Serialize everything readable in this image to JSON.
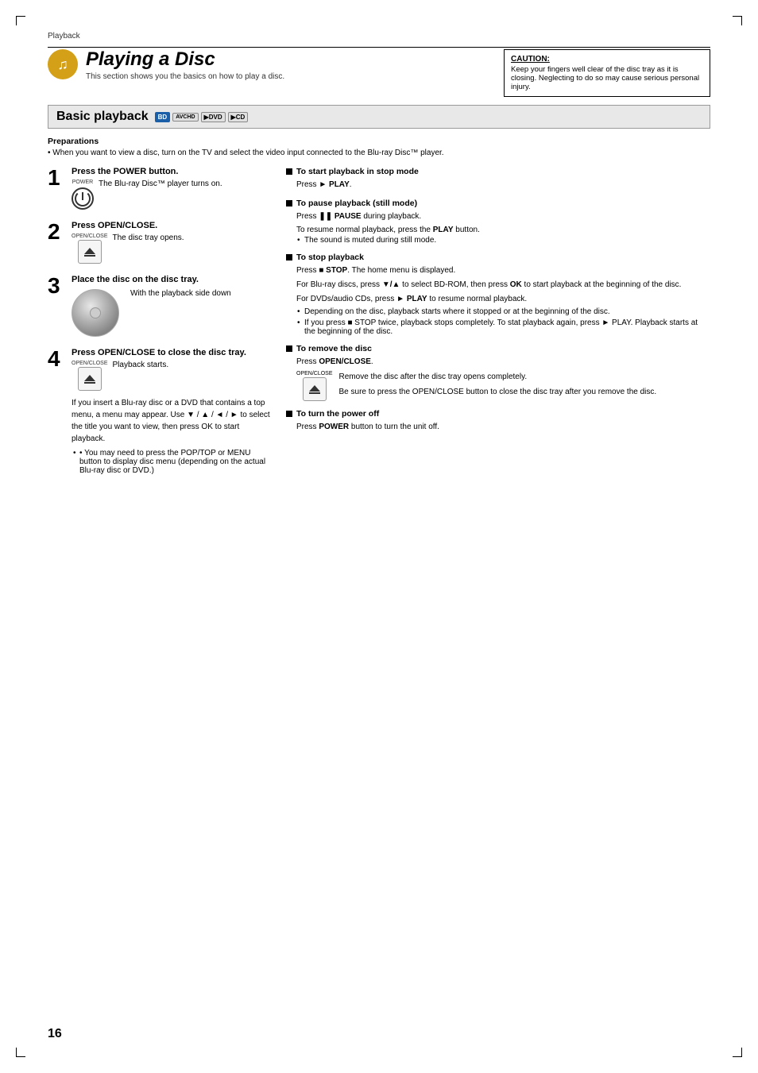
{
  "page": {
    "breadcrumb": "Playback",
    "page_number": "16"
  },
  "header": {
    "title": "Playing a Disc",
    "subtitle": "This section shows you the basics on how to play a disc.",
    "caution": {
      "label": "CAUTION:",
      "text": "Keep your fingers well clear of the disc tray as it is closing. Neglecting to do so may cause serious personal injury."
    }
  },
  "section": {
    "title": "Basic playback",
    "badges": [
      "BD",
      "AVCHD",
      "DVD",
      "CD"
    ]
  },
  "preparations": {
    "title": "Preparations",
    "note": "• When you want to view a disc, turn on the TV and select the video input connected to the Blu-ray Disc™ player."
  },
  "steps": [
    {
      "number": "1",
      "instruction": "Press the POWER button.",
      "label": "POWER",
      "description": "The Blu-ray Disc™ player turns on."
    },
    {
      "number": "2",
      "instruction": "Press OPEN/CLOSE.",
      "label": "OPEN/CLOSE",
      "description": "The disc tray opens."
    },
    {
      "number": "3",
      "instruction": "Place the disc on the disc tray.",
      "description": "With the playback side down"
    },
    {
      "number": "4",
      "instruction": "Press OPEN/CLOSE to close the disc tray.",
      "label": "OPEN/CLOSE",
      "description": "Playback starts.",
      "extra_note1": "If you insert a Blu-ray disc or a DVD that contains a top menu, a menu may appear. Use ▼ / ▲ / ◄ / ► to select the title you want to view, then press OK to start playback.",
      "extra_note2": "• You may need to press the POP/TOP or MENU button to display disc menu (depending on the actual Blu-ray disc or DVD.)"
    }
  ],
  "right_sections": [
    {
      "title": "To start playback in stop mode",
      "body": "Press ► PLAY."
    },
    {
      "title": "To pause playback (still mode)",
      "body": "Press ❚❚ PAUSE during playback.",
      "sub1": "To resume normal playback, press the PLAY button.",
      "sub2": "• The sound is muted during still mode."
    },
    {
      "title": "To stop playback",
      "body1": "Press ■ STOP. The home menu is displayed.",
      "body2": "For Blu-ray discs, press ▼/▲ to select BD-ROM, then press OK to start playback at the beginning of the disc.",
      "body3": "For DVDs/audio CDs, press ► PLAY to resume normal playback.",
      "sub1": "• Depending on the disc, playback starts where it stopped or at the beginning of the disc.",
      "sub2": "• If you press ■ STOP twice, playback stops completely. To stat playback again, press ► PLAY. Playback starts at the beginning of the disc."
    },
    {
      "title": "To remove the disc",
      "body": "Press OPEN/CLOSE.",
      "label": "OPEN/CLOSE",
      "remove1": "Remove the disc after the disc tray opens completely.",
      "remove2": "Be sure to press the OPEN/CLOSE button to close the disc tray after you remove the disc."
    },
    {
      "title": "To turn the power off",
      "body": "Press POWER button to turn the unit off."
    }
  ]
}
